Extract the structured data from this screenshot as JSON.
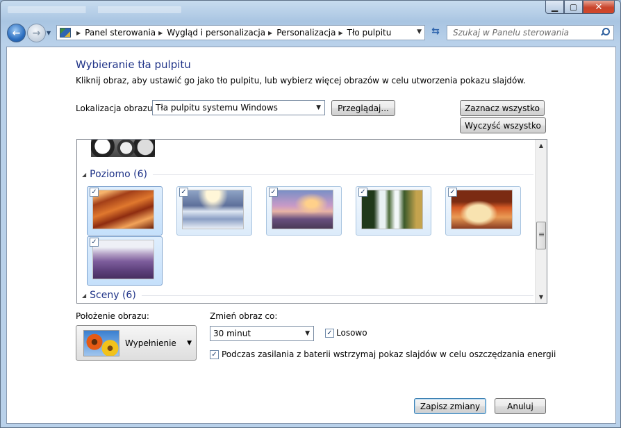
{
  "window": {
    "minimize_icon": "minimize-icon",
    "maximize_icon": "maximize-icon",
    "close_icon": "close-icon"
  },
  "nav": {
    "back_glyph": "←",
    "forward_glyph": "→",
    "breadcrumbs": [
      "Panel sterowania",
      "Wygląd i personalizacja",
      "Personalizacja",
      "Tło pulpitu"
    ],
    "search_placeholder": "Szukaj w Panelu sterowania"
  },
  "page": {
    "title": "Wybieranie tła pulpitu",
    "description": "Kliknij obraz, aby ustawić go jako tło pulpitu, lub wybierz więcej obrazów w celu utworzenia pokazu slajdów.",
    "location_label": "Lokalizacja obrazu:",
    "location_value": "Tła pulpitu systemu Windows",
    "browse_label": "Przeglądaj...",
    "select_all_label": "Zaznacz wszystko",
    "clear_all_label": "Wyczyść wszystko"
  },
  "gallery": {
    "groups": [
      {
        "label": "Poziomo (6)"
      },
      {
        "label": "Sceny (6)"
      }
    ],
    "images": [
      {
        "name": "canyon",
        "checked": true
      },
      {
        "name": "ice-lake",
        "checked": true
      },
      {
        "name": "rocky-shore",
        "checked": true
      },
      {
        "name": "waterfall",
        "checked": true
      },
      {
        "name": "rock-arch",
        "checked": true
      },
      {
        "name": "lavender-field",
        "checked": true
      }
    ]
  },
  "position": {
    "label": "Położenie obrazu:",
    "value": "Wypełnienie"
  },
  "interval": {
    "label": "Zmień obraz co:",
    "value": "30 minut",
    "shuffle_label": "Losowo",
    "shuffle_checked": true,
    "battery_label": "Podczas zasilania z baterii wstrzymaj pokaz slajdów w celu oszczędzania energii",
    "battery_checked": true
  },
  "footer": {
    "save_label": "Zapisz zmiany",
    "cancel_label": "Anuluj"
  },
  "glyphs": {
    "check": "✓",
    "dropdown": "▼",
    "crumb_separator": "▶"
  }
}
